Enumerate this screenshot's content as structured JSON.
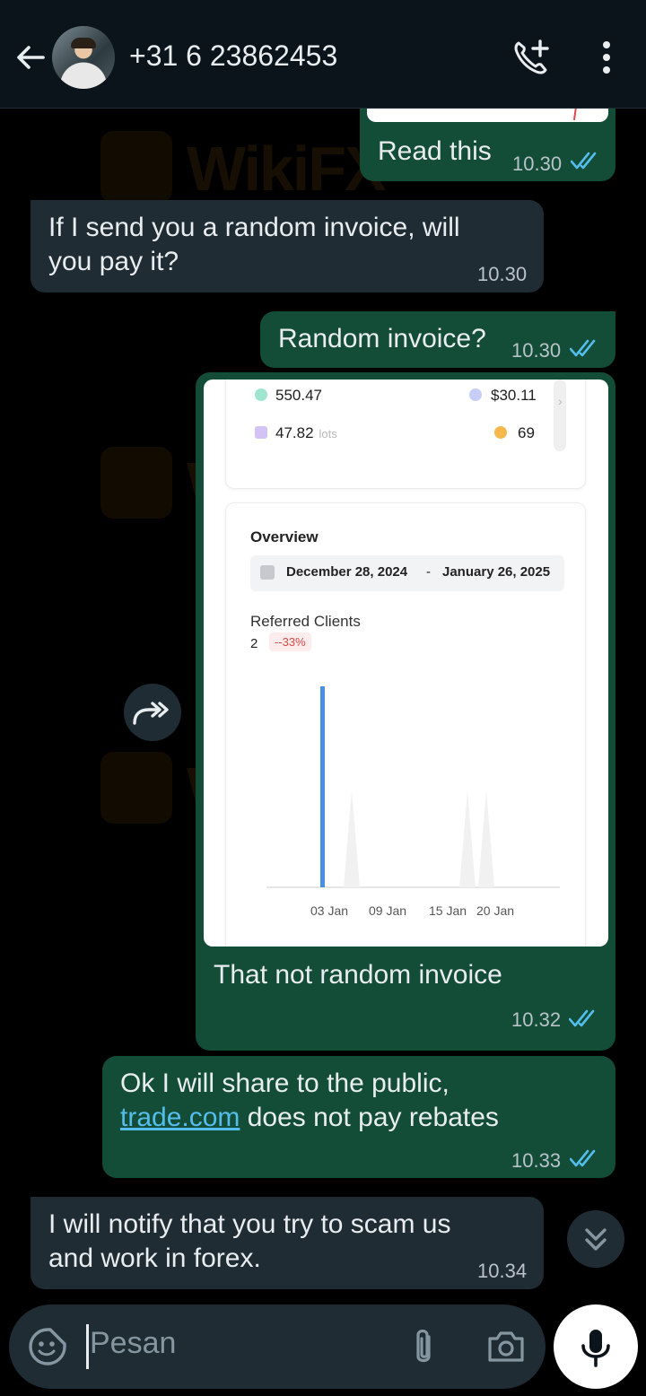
{
  "header": {
    "contact": "+31 6 23862453",
    "back_icon": "arrow-left-icon",
    "call_icon": "add-call-icon",
    "menu_icon": "more-vertical-icon"
  },
  "watermark": {
    "text": "WikiFX"
  },
  "messages": [
    {
      "id": "m1",
      "direction": "outgoing",
      "text": "Read this",
      "time": "10.30",
      "status": "read"
    },
    {
      "id": "m2",
      "direction": "incoming",
      "text_lines": [
        "If I send you a random invoice, will",
        "you pay it?"
      ],
      "time": "10.30"
    },
    {
      "id": "m3",
      "direction": "outgoing",
      "text": "Random invoice?",
      "time": "10.30",
      "status": "read"
    },
    {
      "id": "m4",
      "direction": "outgoing",
      "caption": "That not random invoice",
      "time": "10.32",
      "status": "read",
      "image": {
        "stats": {
          "balance": "550.47",
          "earnings": "$30.11",
          "volume": "47.82",
          "volume_unit": "lots",
          "clients": "69"
        },
        "overview": {
          "title": "Overview",
          "date_from": "December 28, 2024",
          "date_separator": "-",
          "date_to": "January 26, 2025",
          "metric_label": "Referred Clients",
          "metric_value": "2",
          "metric_change": "--33%",
          "axis_ticks": [
            "03 Jan",
            "09 Jan",
            "15 Jan",
            "20 Jan"
          ]
        }
      }
    },
    {
      "id": "m5",
      "direction": "outgoing",
      "line1": "Ok I will share to the public,",
      "link_text": "trade.com",
      "line2_rest": " does not pay rebates",
      "time": "10.33",
      "status": "read"
    },
    {
      "id": "m6",
      "direction": "incoming",
      "text_lines": [
        "I will notify that you try to scam us",
        "and work in forex."
      ],
      "time": "10.34"
    }
  ],
  "composer": {
    "placeholder": "Pesan",
    "emoji_icon": "sticker-smiley-icon",
    "attach_icon": "paperclip-icon",
    "camera_icon": "camera-icon",
    "mic_icon": "microphone-icon"
  },
  "colors": {
    "outgoing_bubble": "#134d37",
    "incoming_bubble": "#1f2c34",
    "read_ticks": "#53bdeb",
    "chart_bar": "#4a90e2"
  }
}
